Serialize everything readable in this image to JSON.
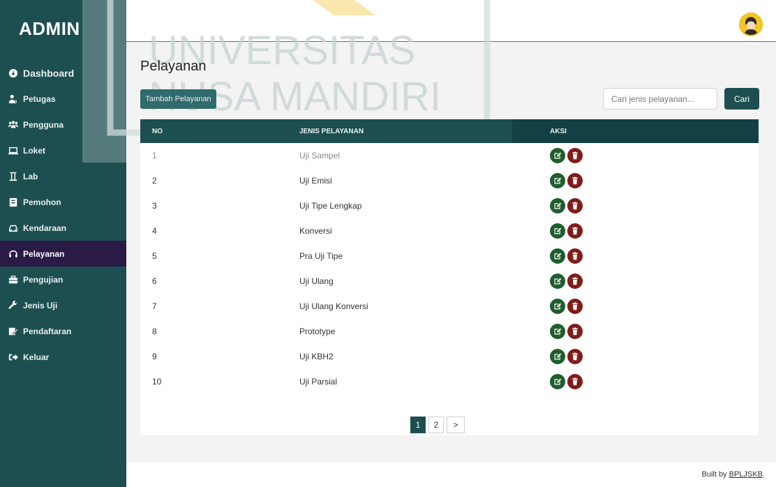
{
  "sidebar": {
    "brand": "ADMIN",
    "items": [
      {
        "label": "Dashboard",
        "icon": "dashboard-icon",
        "active": false
      },
      {
        "label": "Petugas",
        "icon": "user-tie-icon",
        "active": false
      },
      {
        "label": "Pengguna",
        "icon": "users-icon",
        "active": false
      },
      {
        "label": "Loket",
        "icon": "laptop-icon",
        "active": false
      },
      {
        "label": "Lab",
        "icon": "flask-icon",
        "active": false
      },
      {
        "label": "Pemohon",
        "icon": "id-card-icon",
        "active": false
      },
      {
        "label": "Kendaraan",
        "icon": "car-icon",
        "active": false
      },
      {
        "label": "Pelayanan",
        "icon": "headset-icon",
        "active": true
      },
      {
        "label": "Pengujian",
        "icon": "toolbox-icon",
        "active": false
      },
      {
        "label": "Jenis Uji",
        "icon": "wrench-icon",
        "active": false
      },
      {
        "label": "Pendaftaran",
        "icon": "signature-icon",
        "active": false
      },
      {
        "label": "Keluar",
        "icon": "sign-out-icon",
        "active": false
      }
    ]
  },
  "watermark": {
    "line1": "UNIVERSITAS",
    "line2": "NUSA MANDIRI"
  },
  "main": {
    "title": "Pelayanan",
    "add_button": "Tambah Pelayanan",
    "search_placeholder": "Cari jenis pelayanan...",
    "search_button": "Cari"
  },
  "table": {
    "headers": {
      "no": "NO",
      "name": "JENIS PELAYANAN",
      "actions": "AKSI"
    },
    "rows": [
      {
        "no": "1",
        "name": "Uji Sampel"
      },
      {
        "no": "2",
        "name": "Uji Emisi"
      },
      {
        "no": "3",
        "name": "Uji Tipe Lengkap"
      },
      {
        "no": "4",
        "name": "Konversi"
      },
      {
        "no": "5",
        "name": "Pra Uji Tipe"
      },
      {
        "no": "6",
        "name": "Uji Ulang"
      },
      {
        "no": "7",
        "name": "Uji Ulang Konversi"
      },
      {
        "no": "8",
        "name": "Prototype"
      },
      {
        "no": "9",
        "name": "Uji KBH2"
      },
      {
        "no": "10",
        "name": "Uji Parsial"
      }
    ]
  },
  "pagination": {
    "pages": [
      "1",
      "2"
    ],
    "current": "1",
    "next": ">"
  },
  "footer": {
    "prefix": "Built by ",
    "link": "BPLJSKB",
    "suffix": "."
  },
  "colors": {
    "sidebar": "#1d4f51",
    "active_nav": "#2a1a46",
    "edit": "#1f5d2e",
    "delete": "#7e1d1a",
    "accent_yellow": "#f7c51f"
  }
}
